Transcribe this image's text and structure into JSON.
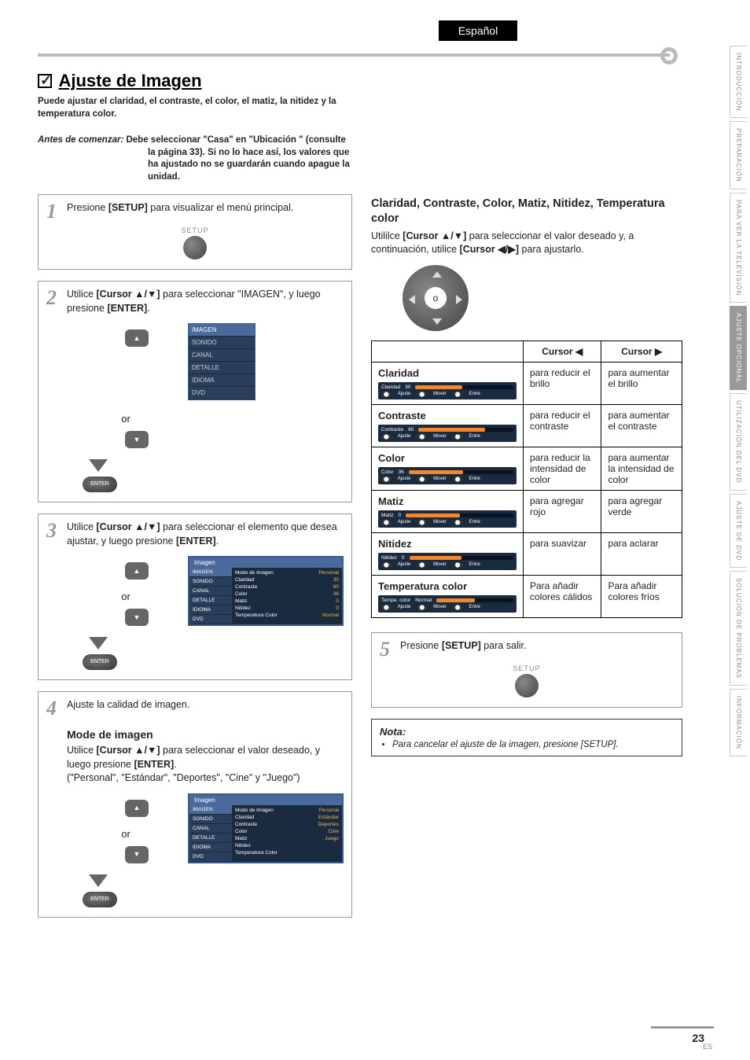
{
  "lang_tab": "Español",
  "side_tabs": [
    "INTRODUCCIÓN",
    "PREPARACIÓN",
    "PARA VER LA TELEVISIÓN",
    "AJUSTE OPCIONAL",
    "UTILIZACIÓN DEL DVD",
    "AJUSTE DE DVD",
    "SOLUCIÓN DE PROBLEMAS",
    "INFORMACIÓN"
  ],
  "active_tab_index": 3,
  "title": "Ajuste de Imagen",
  "intro": "Puede ajustar el claridad, el contraste, el color, el matiz, la nitidez y la temperatura color.",
  "before_label": "Antes de comenzar:",
  "before_text": "Debe seleccionar \"Casa\" en \"Ubicación \" (consulte la página 33). Si no lo hace así, los valores que ha ajustado no se guardarán cuando apague la unidad.",
  "steps": {
    "s1": {
      "num": "1",
      "text_a": "Presione ",
      "b1": "[SETUP]",
      "text_b": " para visualizar el menú principal.",
      "setup": "SETUP"
    },
    "s2": {
      "num": "2",
      "text_a": "Utilice ",
      "b1": "[Cursor ▲/▼]",
      "text_b": " para seleccionar \"IMAGEN\", y luego presione ",
      "b2": "[ENTER]",
      "text_c": ".",
      "enter": "ENTER",
      "or": "or"
    },
    "s3": {
      "num": "3",
      "text_a": "Utilice ",
      "b1": "[Cursor ▲/▼]",
      "text_b": " para seleccionar el elemento que desea ajustar, y luego presione ",
      "b2": "[ENTER]",
      "text_c": ".",
      "or": "or",
      "enter": "ENTER"
    },
    "s4": {
      "num": "4",
      "text": "Ajuste la calidad de imagen."
    },
    "s5": {
      "num": "5",
      "text_a": "Presione ",
      "b1": "[SETUP]",
      "text_b": " para salir.",
      "setup": "SETUP"
    }
  },
  "mode_h": "Mode de imagen",
  "mode_p1a": "Utilice ",
  "mode_p1b": "[Cursor ▲/▼]",
  "mode_p1c": " para seleccionar el valor deseado, y luego presione ",
  "mode_p1d": "[ENTER]",
  "mode_p1e": ".",
  "mode_p2": "(\"Personal\", \"Estándar\", \"Deportes\", \"Cine\" y \"Juego\")",
  "or": "or",
  "enter": "ENTER",
  "menu_items": [
    "IMAGEN",
    "SONIDO",
    "CANAL",
    "DETALLE",
    "IDIOMA",
    "DVD"
  ],
  "img_panel_title": "Imagen",
  "img_rows": [
    {
      "l": "Modo de Imagen",
      "v": "Personal"
    },
    {
      "l": "Claridad",
      "v": "30"
    },
    {
      "l": "Contraste",
      "v": "60"
    },
    {
      "l": "Color",
      "v": "36"
    },
    {
      "l": "Matiz",
      "v": "0"
    },
    {
      "l": "Nitidez",
      "v": "0"
    },
    {
      "l": "Temperatura Color",
      "v": "Normal"
    }
  ],
  "img_rows2": [
    {
      "l": "Modo de Imagen",
      "v": "Personal"
    },
    {
      "l": "Claridad",
      "v": "Estándar"
    },
    {
      "l": "Contraste",
      "v": "Deportes"
    },
    {
      "l": "Color",
      "v": "Cine"
    },
    {
      "l": "Matiz",
      "v": "Juego"
    },
    {
      "l": "Nitidez",
      "v": ""
    },
    {
      "l": "Temperatura Color",
      "v": ""
    }
  ],
  "sec2_h": "Claridad, Contraste, Color, Matiz, Nitidez, Temperatura color",
  "sec2_p_a": "Utililce ",
  "sec2_p_b": "[Cursor ▲/▼]",
  "sec2_p_c": " para seleccionar el valor deseado y, a continuación, utilice ",
  "sec2_p_d": "[Cursor ◀/▶]",
  "sec2_p_e": " para ajustarlo.",
  "table": {
    "h_left": "Cursor ◀",
    "h_right": "Cursor ▶",
    "rows": [
      {
        "name": "Claridad",
        "slider": {
          "label": "Claridad",
          "val": "30",
          "fill": 48
        },
        "left": "para reducir el brillo",
        "right": "para aumentar el brillo"
      },
      {
        "name": "Contraste",
        "slider": {
          "label": "Contraste",
          "val": "60",
          "fill": 70
        },
        "left": "para reducir el contraste",
        "right": "para aumentar el contraste"
      },
      {
        "name": "Color",
        "slider": {
          "label": "Color",
          "val": "36",
          "fill": 52
        },
        "left": "para reducir la intensidad de color",
        "right": "para aumentar la intensidad de color"
      },
      {
        "name": "Matiz",
        "slider": {
          "label": "Matiz",
          "val": "0",
          "fill": 50
        },
        "left": "para agregar rojo",
        "right": "para agregar verde"
      },
      {
        "name": "Nitidez",
        "slider": {
          "label": "Nitidez",
          "val": "0",
          "fill": 50
        },
        "left": "para suavizar",
        "right": "para aclarar"
      },
      {
        "name": "Temperatura color",
        "slider": {
          "label": "Tempe. color",
          "val": "Normal",
          "fill": 50
        },
        "left": "Para añadir colores cálidos",
        "right": "Para añadir colores fríos"
      }
    ],
    "slider_btm": [
      "Ajuste",
      "Mover",
      "Entre"
    ]
  },
  "note_h": "Nota:",
  "note_item": "Para cancelar el ajuste de la imagen, presione [SETUP].",
  "page_num": "23",
  "page_es": "ES"
}
